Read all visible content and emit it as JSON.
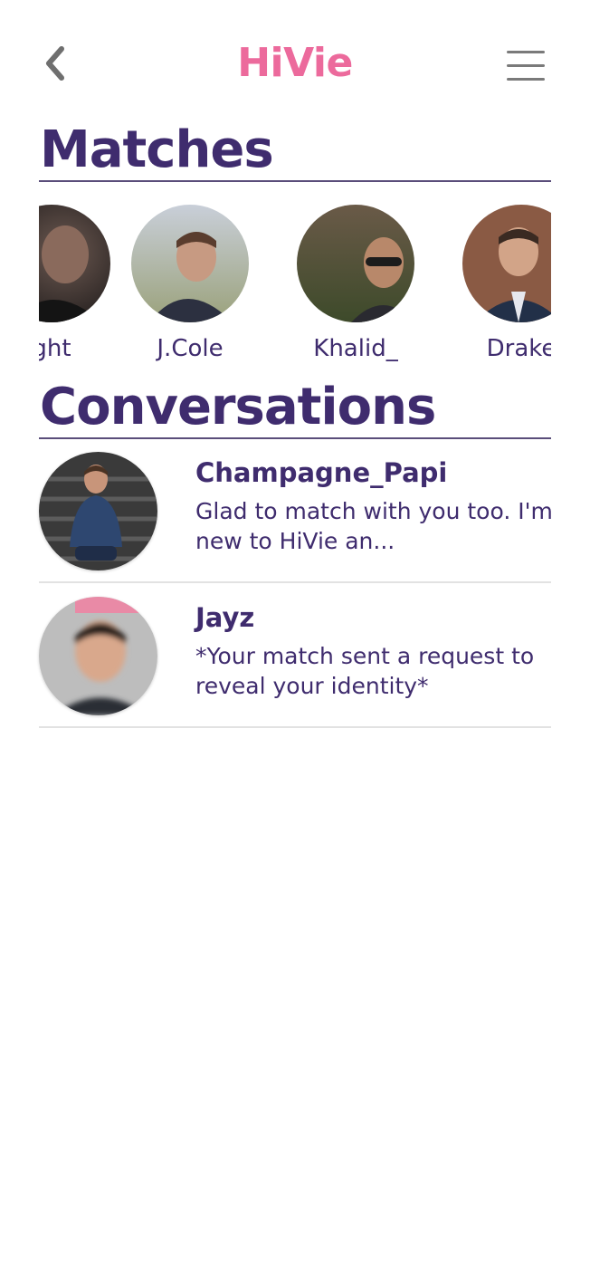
{
  "app": {
    "title": "HiVie"
  },
  "header": {
    "back_icon": "chevron-left-icon",
    "menu_icon": "hamburger-menu-icon"
  },
  "colors": {
    "brand_pink": "#ec6a9c",
    "heading_purple": "#3f2c6e",
    "name_purple": "#3f2c6e",
    "divider_purple": "#5a4d7a",
    "divider_gray": "#e2e2e2",
    "icon_gray": "#7a7a7a"
  },
  "matches": {
    "heading": "Matches",
    "items": [
      {
        "name": "ght"
      },
      {
        "name": "J.Cole"
      },
      {
        "name": "Khalid_"
      },
      {
        "name": "Drake"
      }
    ]
  },
  "conversations": {
    "heading": "Conversations",
    "items": [
      {
        "name": "Champagne_Papi",
        "message": "Glad to match with you too. I'm new to HiVie an..."
      },
      {
        "name": "Jayz",
        "message": "*Your match sent a request to reveal your identity*"
      }
    ]
  }
}
